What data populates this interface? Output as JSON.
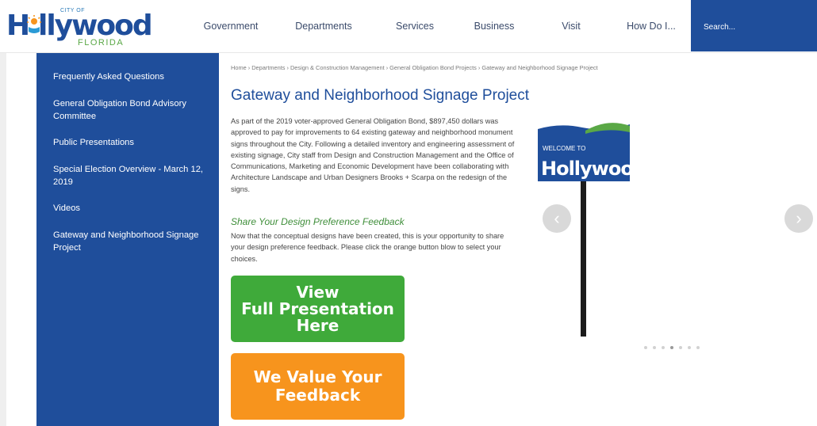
{
  "logo": {
    "city_of": "CITY OF",
    "h": "H",
    "wood": "llywood",
    "florida": "FLORIDA"
  },
  "nav": [
    "Government",
    "Departments",
    "Services",
    "Business",
    "Visit",
    "How Do I..."
  ],
  "search": {
    "placeholder": "Search..."
  },
  "sidebar": {
    "items": [
      "Frequently Asked Questions",
      "General Obligation Bond Advisory Committee",
      "Public Presentations",
      "Special Election Overview - March 12, 2019",
      "Videos",
      "Gateway and Neighborhood Signage Project"
    ]
  },
  "breadcrumb": [
    "Home",
    "Departments",
    "Design & Construction Management",
    "General Obligation Bond Projects",
    "Gateway and Neighborhood Signage Project"
  ],
  "breadcrumb_sep": "›",
  "page_title": "Gateway and Neighborhood Signage Project",
  "intro": "As part of the 2019 voter-approved General Obligation Bond, $897,450 dollars was approved to pay for improvements to 64 existing gateway and neighborhood monument signs throughout the City. Following a detailed inventory and engineering assessment of existing signage, City staff from Design and Construction Management and the Office of Communications, Marketing and Economic Development have been collaborating with Architecture Landscape and Urban Designers Brooks + Scarpa on the redesign of the signs.",
  "subhead": "Share Your Design Preference Feedback",
  "subtext": "Now that the conceptual designs have been created, this is your opportunity to share your design preference feedback. Please click the orange button blow to select your choices.",
  "buttons": {
    "view": [
      "View",
      "Full Presentation",
      "Here"
    ],
    "feedback": [
      "We Value Your",
      "Feedback"
    ]
  },
  "slide": {
    "welcome": "WELCOME TO",
    "brand": "Hollywood"
  },
  "colors": {
    "primary": "#1f4e9b",
    "green": "#3faa3a",
    "orange": "#f7941d",
    "accent_green": "#5aa846"
  },
  "slideshow": {
    "dot_count": 7,
    "active_dot": 3
  }
}
